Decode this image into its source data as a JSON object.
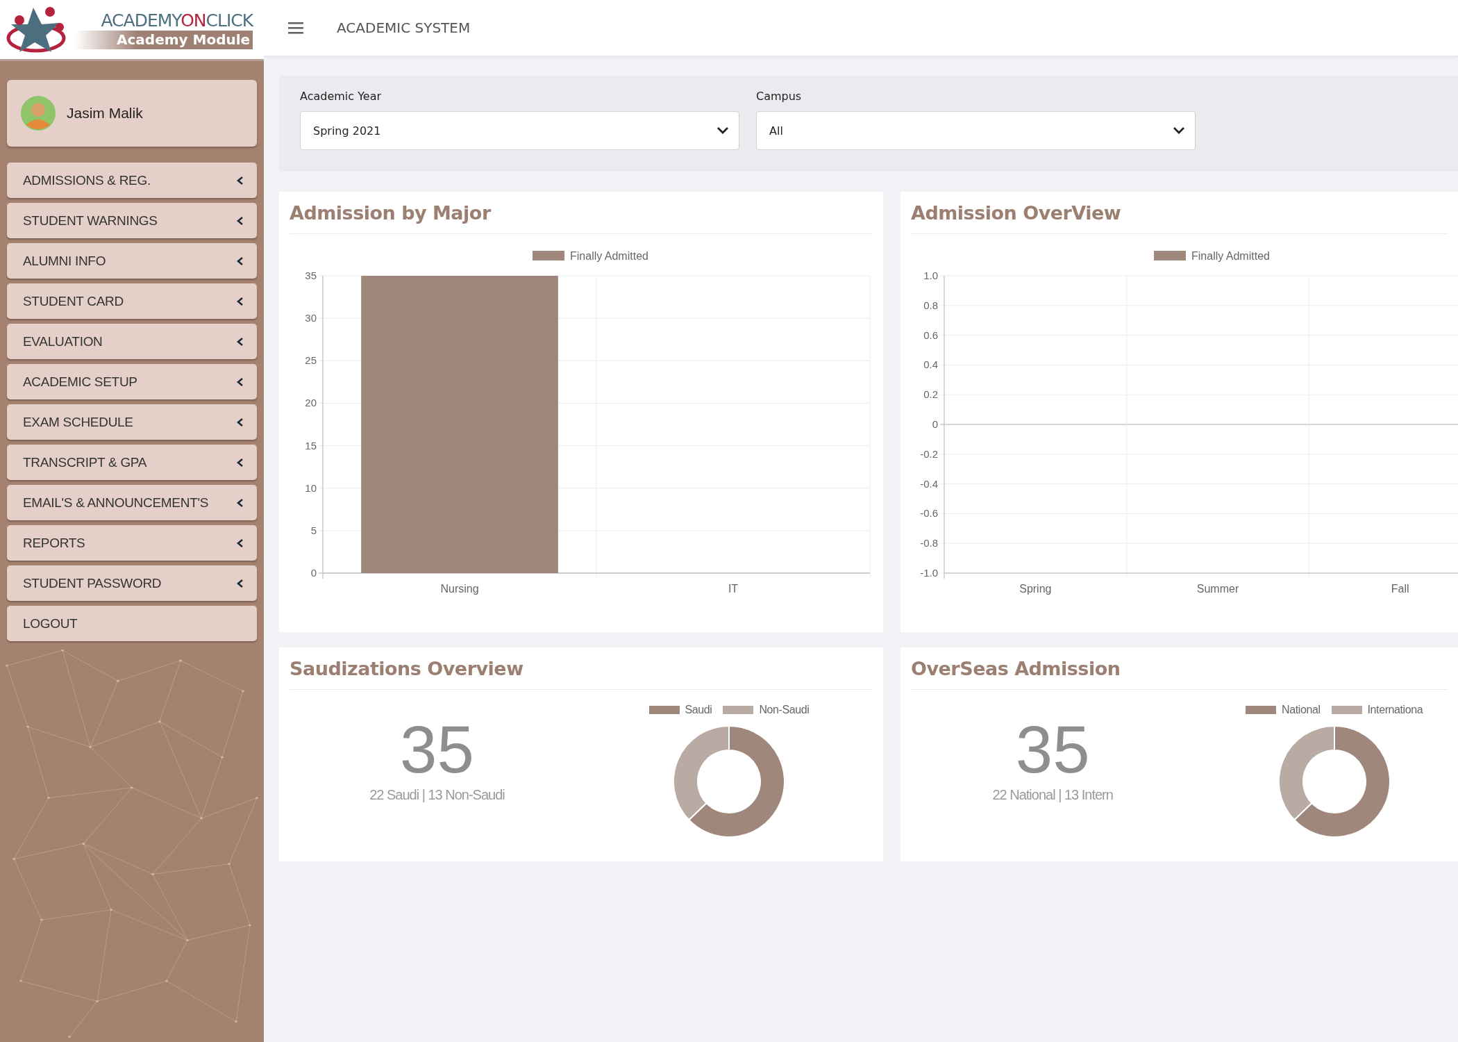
{
  "logo": {
    "wordmark": [
      "ACADEMY",
      "ON",
      "CLICK"
    ],
    "subtitle": "Academy Module"
  },
  "user": {
    "name": "Jasim Malik"
  },
  "sidebar": {
    "items": [
      {
        "label": "ADMISSIONS & REG.",
        "has_submenu": true
      },
      {
        "label": "STUDENT WARNINGS",
        "has_submenu": true
      },
      {
        "label": "ALUMNI INFO",
        "has_submenu": true
      },
      {
        "label": "STUDENT CARD",
        "has_submenu": true
      },
      {
        "label": "EVALUATION",
        "has_submenu": true
      },
      {
        "label": "ACADEMIC SETUP",
        "has_submenu": true
      },
      {
        "label": "EXAM SCHEDULE",
        "has_submenu": true
      },
      {
        "label": "TRANSCRIPT & GPA",
        "has_submenu": true
      },
      {
        "label": "EMAIL'S & ANNOUNCEMENT'S",
        "has_submenu": true
      },
      {
        "label": "REPORTS",
        "has_submenu": true
      },
      {
        "label": "STUDENT PASSWORD",
        "has_submenu": true
      },
      {
        "label": "LOGOUT",
        "has_submenu": false
      }
    ]
  },
  "header": {
    "title": "ACADEMIC SYSTEM"
  },
  "filters": [
    {
      "label": "Academic Year",
      "value": "Spring 2021"
    },
    {
      "label": "Campus",
      "value": "All"
    }
  ],
  "panels": [
    {
      "title": "Admission by Major",
      "chart_data": {
        "type": "bar",
        "grid": true,
        "categories": [
          "Nursing",
          "IT"
        ],
        "series": [
          {
            "name": "Finally Admitted",
            "color": "#a0877b",
            "values": [
              35,
              0
            ]
          }
        ],
        "ylim": [
          0,
          35
        ],
        "yticks": [
          0,
          5,
          10,
          15,
          20,
          25,
          30,
          35
        ]
      }
    },
    {
      "title": "Admission OverView",
      "chart_data": {
        "type": "bar",
        "grid": true,
        "categories": [
          "Spring",
          "Summer",
          "Fall"
        ],
        "series": [
          {
            "name": "Finally Admitted",
            "color": "#a0877b",
            "values": [
              null,
              null,
              null
            ]
          }
        ],
        "ylim": [
          -1,
          1
        ],
        "yticks": [
          {
            "value": -1,
            "label": "-1.0"
          },
          {
            "value": -0.8,
            "label": "-0.8"
          },
          {
            "value": -0.6,
            "label": "-0.6"
          },
          {
            "value": -0.4,
            "label": "-0.4"
          },
          {
            "value": -0.2,
            "label": "-0.2"
          },
          {
            "value": 0,
            "label": "0"
          },
          {
            "value": 0.2,
            "label": "0.2"
          },
          {
            "value": 0.4,
            "label": "0.4"
          },
          {
            "value": 0.6,
            "label": "0.6"
          },
          {
            "value": 0.8,
            "label": "0.8"
          },
          {
            "value": 1,
            "label": "1.0"
          }
        ]
      }
    },
    {
      "title": "Saudizations Overview",
      "total": "35",
      "breakdown": "22 Saudi | 13 Non-Saudi",
      "chart_data": {
        "type": "donut",
        "legend": "top",
        "categories": [
          "Saudi",
          "Non-Saudi"
        ],
        "colors": [
          "#a0877b",
          "#b9aaa4"
        ],
        "values": [
          62.86,
          37.14
        ]
      }
    },
    {
      "title": "OverSeas Admission",
      "total": "35",
      "breakdown": "22 National | 13 Intern",
      "chart_data": {
        "type": "donut",
        "legend": "top",
        "categories": [
          "National",
          "Internationa"
        ],
        "colors": [
          "#a0877b",
          "#b9aaa4"
        ],
        "values": [
          62.86,
          37.14
        ]
      }
    }
  ]
}
